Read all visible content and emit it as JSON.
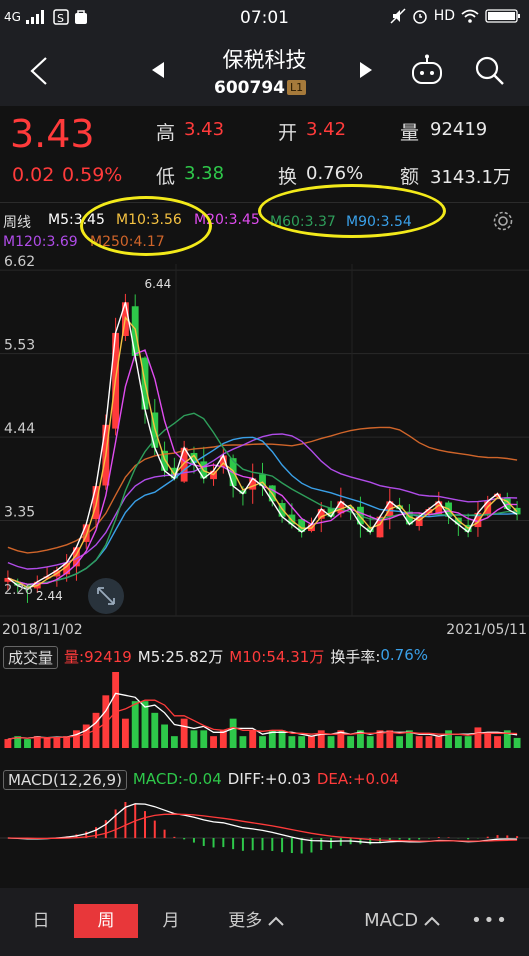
{
  "status_bar": {
    "network": "4G",
    "time": "07:01",
    "hd": "HD"
  },
  "header": {
    "name": "保税科技",
    "code": "600794",
    "badge": "L1"
  },
  "quote": {
    "price": "3.43",
    "change": "0.02",
    "change_pct": "0.59%",
    "high_label": "高",
    "high": "3.43",
    "open_label": "开",
    "open": "3.42",
    "volume_label": "量",
    "volume": "92419",
    "low_label": "低",
    "low": "3.38",
    "turnover_label": "换",
    "turnover": "0.76%",
    "amount_label": "额",
    "amount": "3143.1万"
  },
  "ma": {
    "period": "周线",
    "ma5": "M5:3.45",
    "ma10": "M10:3.56",
    "ma20": "M20:3.45",
    "ma60": "M60:3.37",
    "ma90": "M90:3.54",
    "ma120": "M120:3.69",
    "ma250": "M250:4.17",
    "marker": "6.44"
  },
  "colors": {
    "up": "#ff3b3b",
    "down": "#2ec84a",
    "ma5": "#ffffff",
    "ma10": "#f5c242",
    "ma20": "#e04cf0",
    "ma60": "#2e9e5a",
    "ma90": "#3aa0e8",
    "ma120": "#b04ce8",
    "ma250": "#d0652a",
    "highlight": "#f3ea1a"
  },
  "chart_data": {
    "type": "candlestick",
    "y_ticks": [
      "6.62",
      "5.53",
      "4.44",
      "3.35"
    ],
    "ylim": [
      2.26,
      6.7
    ],
    "x_start": "2018/11/02",
    "x_end": "2021/05/11",
    "low_label": "2.44",
    "low_corner": "2.26",
    "closes": [
      2.6,
      2.5,
      2.45,
      2.55,
      2.62,
      2.7,
      2.8,
      3.0,
      3.3,
      3.8,
      4.6,
      5.8,
      6.2,
      5.5,
      4.8,
      4.3,
      4.0,
      3.9,
      4.3,
      4.1,
      3.9,
      4.0,
      4.2,
      3.8,
      3.7,
      3.9,
      3.8,
      3.6,
      3.4,
      3.3,
      3.2,
      3.3,
      3.5,
      3.4,
      3.6,
      3.5,
      3.3,
      3.2,
      3.4,
      3.6,
      3.5,
      3.3,
      3.4,
      3.5,
      3.6,
      3.4,
      3.3,
      3.2,
      3.45,
      3.6,
      3.7,
      3.5,
      3.43
    ]
  },
  "volume": {
    "label": "成交量",
    "vol": "量:92419",
    "m5": "M5:25.82万",
    "m10": "M10:54.31万",
    "turnover_label": "换手率:",
    "turnover": "0.76%"
  },
  "macd": {
    "label": "MACD(12,26,9)",
    "macd_label": "MACD:",
    "macd": "-0.04",
    "diff_label": "DIFF:",
    "diff": "+0.03",
    "dea_label": "DEA:",
    "dea": "+0.04"
  },
  "tabs": {
    "day": "日",
    "week": "周",
    "month": "月",
    "more": "更多",
    "indicator": "MACD",
    "dots": "•••"
  }
}
